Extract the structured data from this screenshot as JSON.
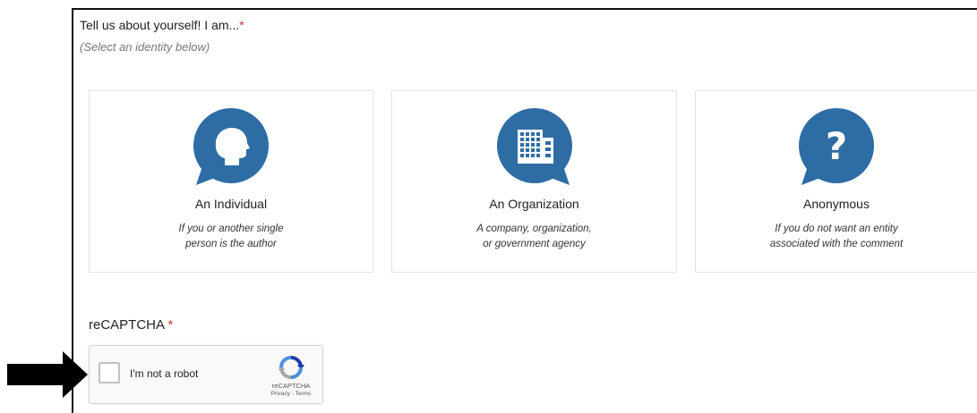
{
  "question": {
    "title": "Tell us about yourself! I am...",
    "required_mark": "*",
    "hint": "(Select an identity below)"
  },
  "identity_options": [
    {
      "title": "An Individual",
      "desc_line1": "If you or another single",
      "desc_line2": "person is the author",
      "icon": "person-head-icon"
    },
    {
      "title": "An Organization",
      "desc_line1": "A company, organization,",
      "desc_line2": "or government agency",
      "icon": "building-icon"
    },
    {
      "title": "Anonymous",
      "desc_line1": "If you do not want an entity",
      "desc_line2": "associated with the comment",
      "icon": "question-mark-icon"
    }
  ],
  "captcha": {
    "label": "reCAPTCHA",
    "required_mark": "*",
    "checkbox_text": "I'm not a robot",
    "brand": "reCAPTCHA",
    "privacy": "Privacy",
    "separator": " - ",
    "terms": "Terms"
  },
  "colors": {
    "icon_blue": "#2e6da4",
    "required_red": "#c0392b",
    "arrow": "#000000"
  }
}
